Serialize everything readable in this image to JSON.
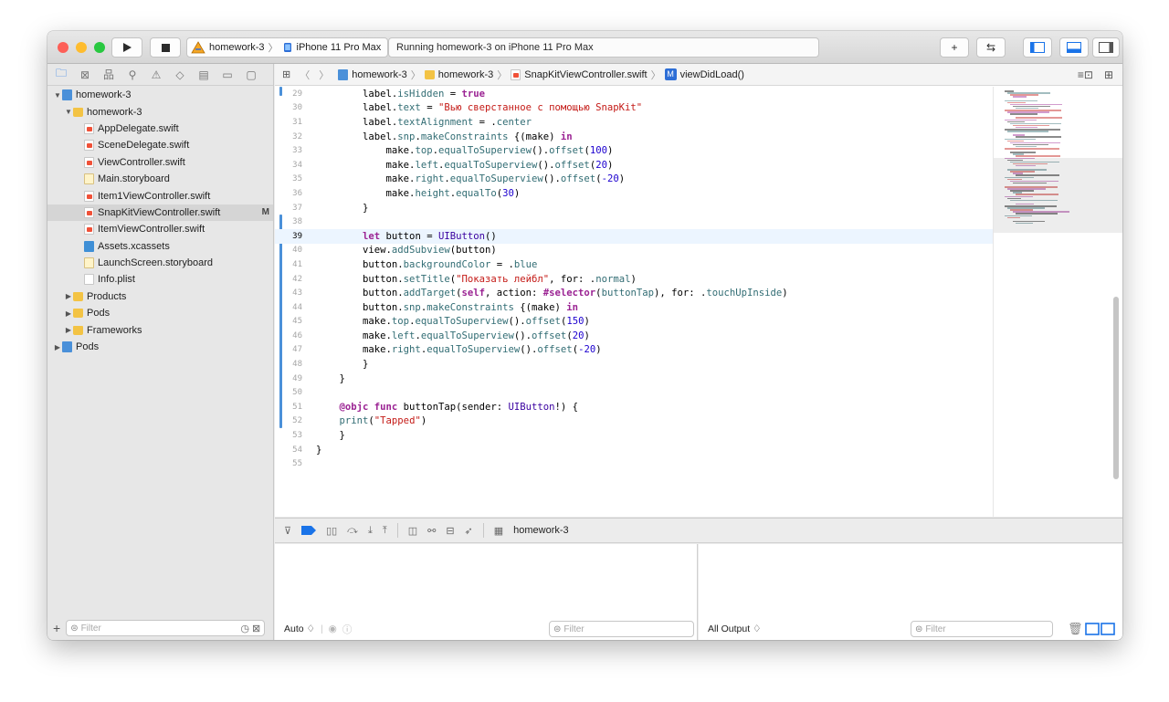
{
  "toolbar": {
    "traffic_colors": [
      "#fd5f57",
      "#febc2e",
      "#28c840"
    ],
    "run_icon": "play-icon",
    "stop_icon": "stop-icon",
    "scheme_name": "homework-3",
    "device_name": "iPhone 11 Pro Max",
    "status_text": "Running homework-3 on iPhone 11 Pro Max",
    "add_label": "+",
    "swap_label": "⇆"
  },
  "navigator": {
    "tabs": [
      "folder-icon",
      "source-control-icon",
      "hierarchy-icon",
      "search-icon",
      "warning-icon",
      "test-icon",
      "debug-icon",
      "breakpoint-icon",
      "report-icon"
    ],
    "tree": [
      {
        "label": "homework-3",
        "icon": "project",
        "indent": 0,
        "disclosure": "open"
      },
      {
        "label": "homework-3",
        "icon": "folder",
        "indent": 1,
        "disclosure": "open"
      },
      {
        "label": "AppDelegate.swift",
        "icon": "swift",
        "indent": 2,
        "disclosure": ""
      },
      {
        "label": "SceneDelegate.swift",
        "icon": "swift",
        "indent": 2,
        "disclosure": ""
      },
      {
        "label": "ViewController.swift",
        "icon": "swift",
        "indent": 2,
        "disclosure": ""
      },
      {
        "label": "Main.storyboard",
        "icon": "storyboard",
        "indent": 2,
        "disclosure": ""
      },
      {
        "label": "Item1ViewController.swift",
        "icon": "swift",
        "indent": 2,
        "disclosure": ""
      },
      {
        "label": "SnapKitViewController.swift",
        "icon": "swift",
        "indent": 2,
        "disclosure": "",
        "selected": true,
        "badge": "M"
      },
      {
        "label": "ItemViewController.swift",
        "icon": "swift",
        "indent": 2,
        "disclosure": ""
      },
      {
        "label": "Assets.xcassets",
        "icon": "assets",
        "indent": 2,
        "disclosure": ""
      },
      {
        "label": "LaunchScreen.storyboard",
        "icon": "storyboard",
        "indent": 2,
        "disclosure": ""
      },
      {
        "label": "Info.plist",
        "icon": "plist",
        "indent": 2,
        "disclosure": ""
      },
      {
        "label": "Products",
        "icon": "folder",
        "indent": 1,
        "disclosure": "closed"
      },
      {
        "label": "Pods",
        "icon": "folder",
        "indent": 1,
        "disclosure": "closed"
      },
      {
        "label": "Frameworks",
        "icon": "folder",
        "indent": 1,
        "disclosure": "closed"
      },
      {
        "label": "Pods",
        "icon": "project",
        "indent": 0,
        "disclosure": "closed"
      }
    ],
    "filter_placeholder": "Filter",
    "add_label": "+"
  },
  "jumpbar": {
    "items": [
      "homework-3",
      "homework-3",
      "SnapKitViewController.swift",
      "viewDidLoad()"
    ],
    "method_badge": "M"
  },
  "editor": {
    "current_line": 39,
    "colors": {
      "keyword": "#9b2393",
      "string": "#c41a16",
      "number": "#1c00cf",
      "type": "#3900a0",
      "member": "#326d74",
      "plain": "#000000"
    },
    "lines": [
      {
        "n": 29,
        "tokens": [
          [
            "p",
            "        label."
          ],
          [
            "m",
            "isHidden"
          ],
          [
            "p",
            " = "
          ],
          [
            "k",
            "true"
          ]
        ]
      },
      {
        "n": 30,
        "tokens": [
          [
            "p",
            "        label."
          ],
          [
            "m",
            "text"
          ],
          [
            "p",
            " = "
          ],
          [
            "s",
            "\"Вью сверстанное с помощью SnapKit\""
          ]
        ]
      },
      {
        "n": 31,
        "tokens": [
          [
            "p",
            "        label."
          ],
          [
            "m",
            "textAlignment"
          ],
          [
            "p",
            " = ."
          ],
          [
            "m",
            "center"
          ]
        ]
      },
      {
        "n": 32,
        "tokens": [
          [
            "p",
            "        label."
          ],
          [
            "m",
            "snp"
          ],
          [
            "p",
            "."
          ],
          [
            "m",
            "makeConstraints"
          ],
          [
            "p",
            " {(make) "
          ],
          [
            "k",
            "in"
          ]
        ]
      },
      {
        "n": 33,
        "tokens": [
          [
            "p",
            "            make."
          ],
          [
            "m",
            "top"
          ],
          [
            "p",
            "."
          ],
          [
            "m",
            "equalToSuperview"
          ],
          [
            "p",
            "()."
          ],
          [
            "m",
            "offset"
          ],
          [
            "p",
            "("
          ],
          [
            "n",
            "100"
          ],
          [
            "p",
            ")"
          ]
        ]
      },
      {
        "n": 34,
        "tokens": [
          [
            "p",
            "            make."
          ],
          [
            "m",
            "left"
          ],
          [
            "p",
            "."
          ],
          [
            "m",
            "equalToSuperview"
          ],
          [
            "p",
            "()."
          ],
          [
            "m",
            "offset"
          ],
          [
            "p",
            "("
          ],
          [
            "n",
            "20"
          ],
          [
            "p",
            ")"
          ]
        ]
      },
      {
        "n": 35,
        "tokens": [
          [
            "p",
            "            make."
          ],
          [
            "m",
            "right"
          ],
          [
            "p",
            "."
          ],
          [
            "m",
            "equalToSuperview"
          ],
          [
            "p",
            "()."
          ],
          [
            "m",
            "offset"
          ],
          [
            "p",
            "("
          ],
          [
            "n",
            "-20"
          ],
          [
            "p",
            ")"
          ]
        ]
      },
      {
        "n": 36,
        "tokens": [
          [
            "p",
            "            make."
          ],
          [
            "m",
            "height"
          ],
          [
            "p",
            "."
          ],
          [
            "m",
            "equalTo"
          ],
          [
            "p",
            "("
          ],
          [
            "n",
            "30"
          ],
          [
            "p",
            ")"
          ]
        ]
      },
      {
        "n": 37,
        "tokens": [
          [
            "p",
            "        }"
          ]
        ]
      },
      {
        "n": 38,
        "tokens": [
          [
            "p",
            ""
          ]
        ]
      },
      {
        "n": 39,
        "tokens": [
          [
            "k",
            "        let"
          ],
          [
            "p",
            " button = "
          ],
          [
            "t",
            "UIButton"
          ],
          [
            "p",
            "()"
          ]
        ]
      },
      {
        "n": 40,
        "tokens": [
          [
            "p",
            "        view."
          ],
          [
            "m",
            "addSubview"
          ],
          [
            "p",
            "(button)"
          ]
        ]
      },
      {
        "n": 41,
        "tokens": [
          [
            "p",
            "        button."
          ],
          [
            "m",
            "backgroundColor"
          ],
          [
            "p",
            " = ."
          ],
          [
            "m",
            "blue"
          ]
        ]
      },
      {
        "n": 42,
        "tokens": [
          [
            "p",
            "        button."
          ],
          [
            "m",
            "setTitle"
          ],
          [
            "p",
            "("
          ],
          [
            "s",
            "\"Показать лейбл\""
          ],
          [
            "p",
            ", for: ."
          ],
          [
            "m",
            "normal"
          ],
          [
            "p",
            ")"
          ]
        ]
      },
      {
        "n": 43,
        "tokens": [
          [
            "p",
            "        button."
          ],
          [
            "m",
            "addTarget"
          ],
          [
            "p",
            "("
          ],
          [
            "k",
            "self"
          ],
          [
            "p",
            ", action: "
          ],
          [
            "k",
            "#selector"
          ],
          [
            "p",
            "("
          ],
          [
            "m",
            "buttonTap"
          ],
          [
            "p",
            "), for: ."
          ],
          [
            "m",
            "touchUpInside"
          ],
          [
            "p",
            ")"
          ]
        ]
      },
      {
        "n": 44,
        "tokens": [
          [
            "p",
            "        button."
          ],
          [
            "m",
            "snp"
          ],
          [
            "p",
            "."
          ],
          [
            "m",
            "makeConstraints"
          ],
          [
            "p",
            " {(make) "
          ],
          [
            "k",
            "in"
          ]
        ]
      },
      {
        "n": 45,
        "tokens": [
          [
            "p",
            "        make."
          ],
          [
            "m",
            "top"
          ],
          [
            "p",
            "."
          ],
          [
            "m",
            "equalToSuperview"
          ],
          [
            "p",
            "()."
          ],
          [
            "m",
            "offset"
          ],
          [
            "p",
            "("
          ],
          [
            "n",
            "150"
          ],
          [
            "p",
            ")"
          ]
        ]
      },
      {
        "n": 46,
        "tokens": [
          [
            "p",
            "        make."
          ],
          [
            "m",
            "left"
          ],
          [
            "p",
            "."
          ],
          [
            "m",
            "equalToSuperview"
          ],
          [
            "p",
            "()."
          ],
          [
            "m",
            "offset"
          ],
          [
            "p",
            "("
          ],
          [
            "n",
            "20"
          ],
          [
            "p",
            ")"
          ]
        ]
      },
      {
        "n": 47,
        "tokens": [
          [
            "p",
            "        make."
          ],
          [
            "m",
            "right"
          ],
          [
            "p",
            "."
          ],
          [
            "m",
            "equalToSuperview"
          ],
          [
            "p",
            "()."
          ],
          [
            "m",
            "offset"
          ],
          [
            "p",
            "("
          ],
          [
            "n",
            "-20"
          ],
          [
            "p",
            ")"
          ]
        ]
      },
      {
        "n": 48,
        "tokens": [
          [
            "p",
            "        }"
          ]
        ]
      },
      {
        "n": 49,
        "tokens": [
          [
            "p",
            "    }"
          ]
        ]
      },
      {
        "n": 50,
        "tokens": [
          [
            "p",
            ""
          ]
        ]
      },
      {
        "n": 51,
        "tokens": [
          [
            "k",
            "    @objc func"
          ],
          [
            "p",
            " buttonTap(sender: "
          ],
          [
            "t",
            "UIButton"
          ],
          [
            "p",
            "!) {"
          ]
        ]
      },
      {
        "n": 52,
        "tokens": [
          [
            "m",
            "    print"
          ],
          [
            "p",
            "("
          ],
          [
            "s",
            "\"Tapped\""
          ],
          [
            "p",
            ")"
          ]
        ]
      },
      {
        "n": 53,
        "tokens": [
          [
            "p",
            "    }"
          ]
        ]
      },
      {
        "n": 54,
        "tokens": [
          [
            "p",
            "}"
          ]
        ]
      },
      {
        "n": 55,
        "tokens": [
          [
            "p",
            ""
          ]
        ]
      }
    ]
  },
  "debugbar": {
    "icons": [
      "hide-debug-icon",
      "breakpoints-icon",
      "pause-icon",
      "step-over-icon",
      "step-into-icon",
      "step-out-icon",
      "view-hierarchy-icon",
      "memory-graph-icon",
      "environment-icon",
      "location-icon"
    ],
    "target": "homework-3"
  },
  "variables_pane": {
    "scope_selector": "Auto ♢",
    "filter_placeholder": "Filter"
  },
  "console_pane": {
    "output_selector": "All Output ♢",
    "filter_placeholder": "Filter"
  }
}
